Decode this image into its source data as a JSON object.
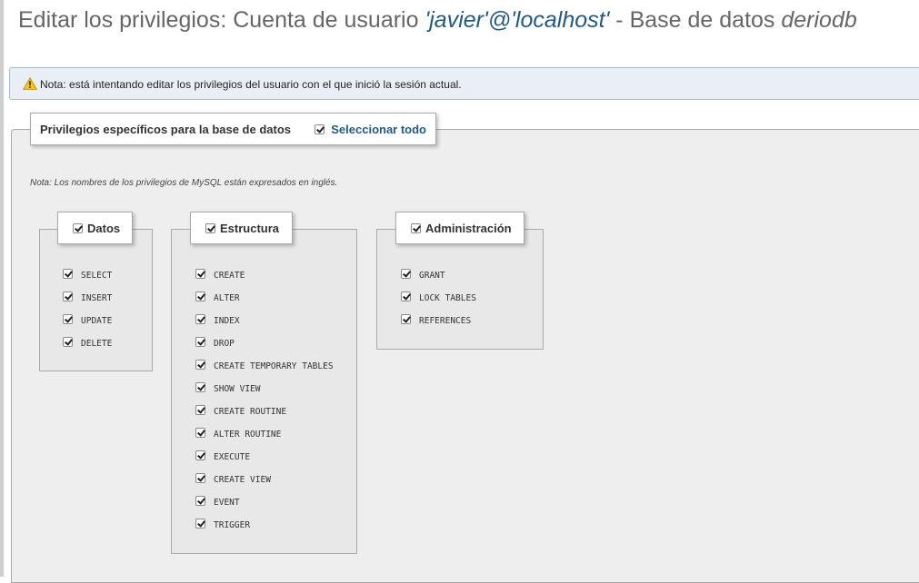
{
  "title": {
    "prefix": "Editar los privilegios: Cuenta de usuario ",
    "user": "'javier'@'localhost'",
    "middle": " - Base de datos ",
    "database": "deriodb"
  },
  "note": {
    "icon": "warning-icon",
    "text": "Nota: está intentando editar los privilegios del usuario con el que inició la sesión actual."
  },
  "privileges": {
    "legend": "Privilegios específicos para la base de datos",
    "select_all": "Seleccionar todo",
    "select_all_checked": true,
    "hint": "Nota: Los nombres de los privilegios de MySQL están expresados en inglés.",
    "groups": [
      {
        "label": "Datos",
        "checked": true,
        "items": [
          "SELECT",
          "INSERT",
          "UPDATE",
          "DELETE"
        ]
      },
      {
        "label": "Estructura",
        "checked": true,
        "items": [
          "CREATE",
          "ALTER",
          "INDEX",
          "DROP",
          "CREATE TEMPORARY TABLES",
          "SHOW VIEW",
          "CREATE ROUTINE",
          "ALTER ROUTINE",
          "EXECUTE",
          "CREATE VIEW",
          "EVENT",
          "TRIGGER"
        ]
      },
      {
        "label": "Administración",
        "checked": true,
        "items": [
          "GRANT",
          "LOCK TABLES",
          "REFERENCES"
        ]
      }
    ]
  },
  "colors": {
    "link": "#235a81",
    "note_background": "#e9eff5",
    "panel_background": "#eeeeee"
  }
}
